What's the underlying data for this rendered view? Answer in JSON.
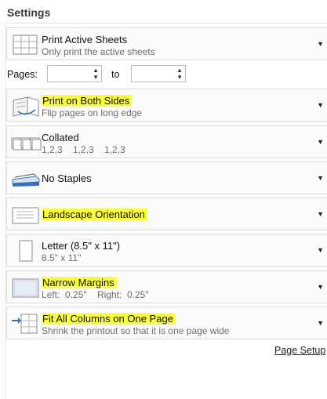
{
  "title": "Settings",
  "pages": {
    "label": "Pages:",
    "to_label": "to",
    "from_value": "",
    "to_value": ""
  },
  "rows": [
    {
      "line1": "Print Active Sheets",
      "line2": "Only print the active sheets",
      "icon": "sheets-icon",
      "highlighted": false
    },
    {
      "line1": "Print on Both Sides",
      "line2": "Flip pages on long edge",
      "icon": "duplex-icon",
      "highlighted": true
    },
    {
      "line1": "Collated",
      "line2": "1,2,3    1,2,3    1,2,3",
      "icon": "collate-icon",
      "highlighted": false
    },
    {
      "line1": "No Staples",
      "line2": "",
      "icon": "stapler-icon",
      "highlighted": false
    },
    {
      "line1": "Landscape Orientation",
      "line2": "",
      "icon": "landscape-icon",
      "highlighted": true
    },
    {
      "line1": "Letter (8.5\" x 11\")",
      "line2": "8.5\" x 11\"",
      "icon": "paper-size-icon",
      "highlighted": false
    },
    {
      "line1": "Narrow Margins",
      "line2": "Left:  0.25\"    Right:  0.25\"",
      "icon": "margins-icon",
      "highlighted": true
    },
    {
      "line1": "Fit All Columns on One Page",
      "line2": "Shrink the printout so that it is one page wide",
      "icon": "scaling-icon",
      "highlighted": true
    }
  ],
  "page_setup_link": "Page Setup",
  "colors": {
    "highlight": "#fbff3f",
    "border": "#d9d9d9",
    "icon_blue": "#3a6fb0"
  }
}
